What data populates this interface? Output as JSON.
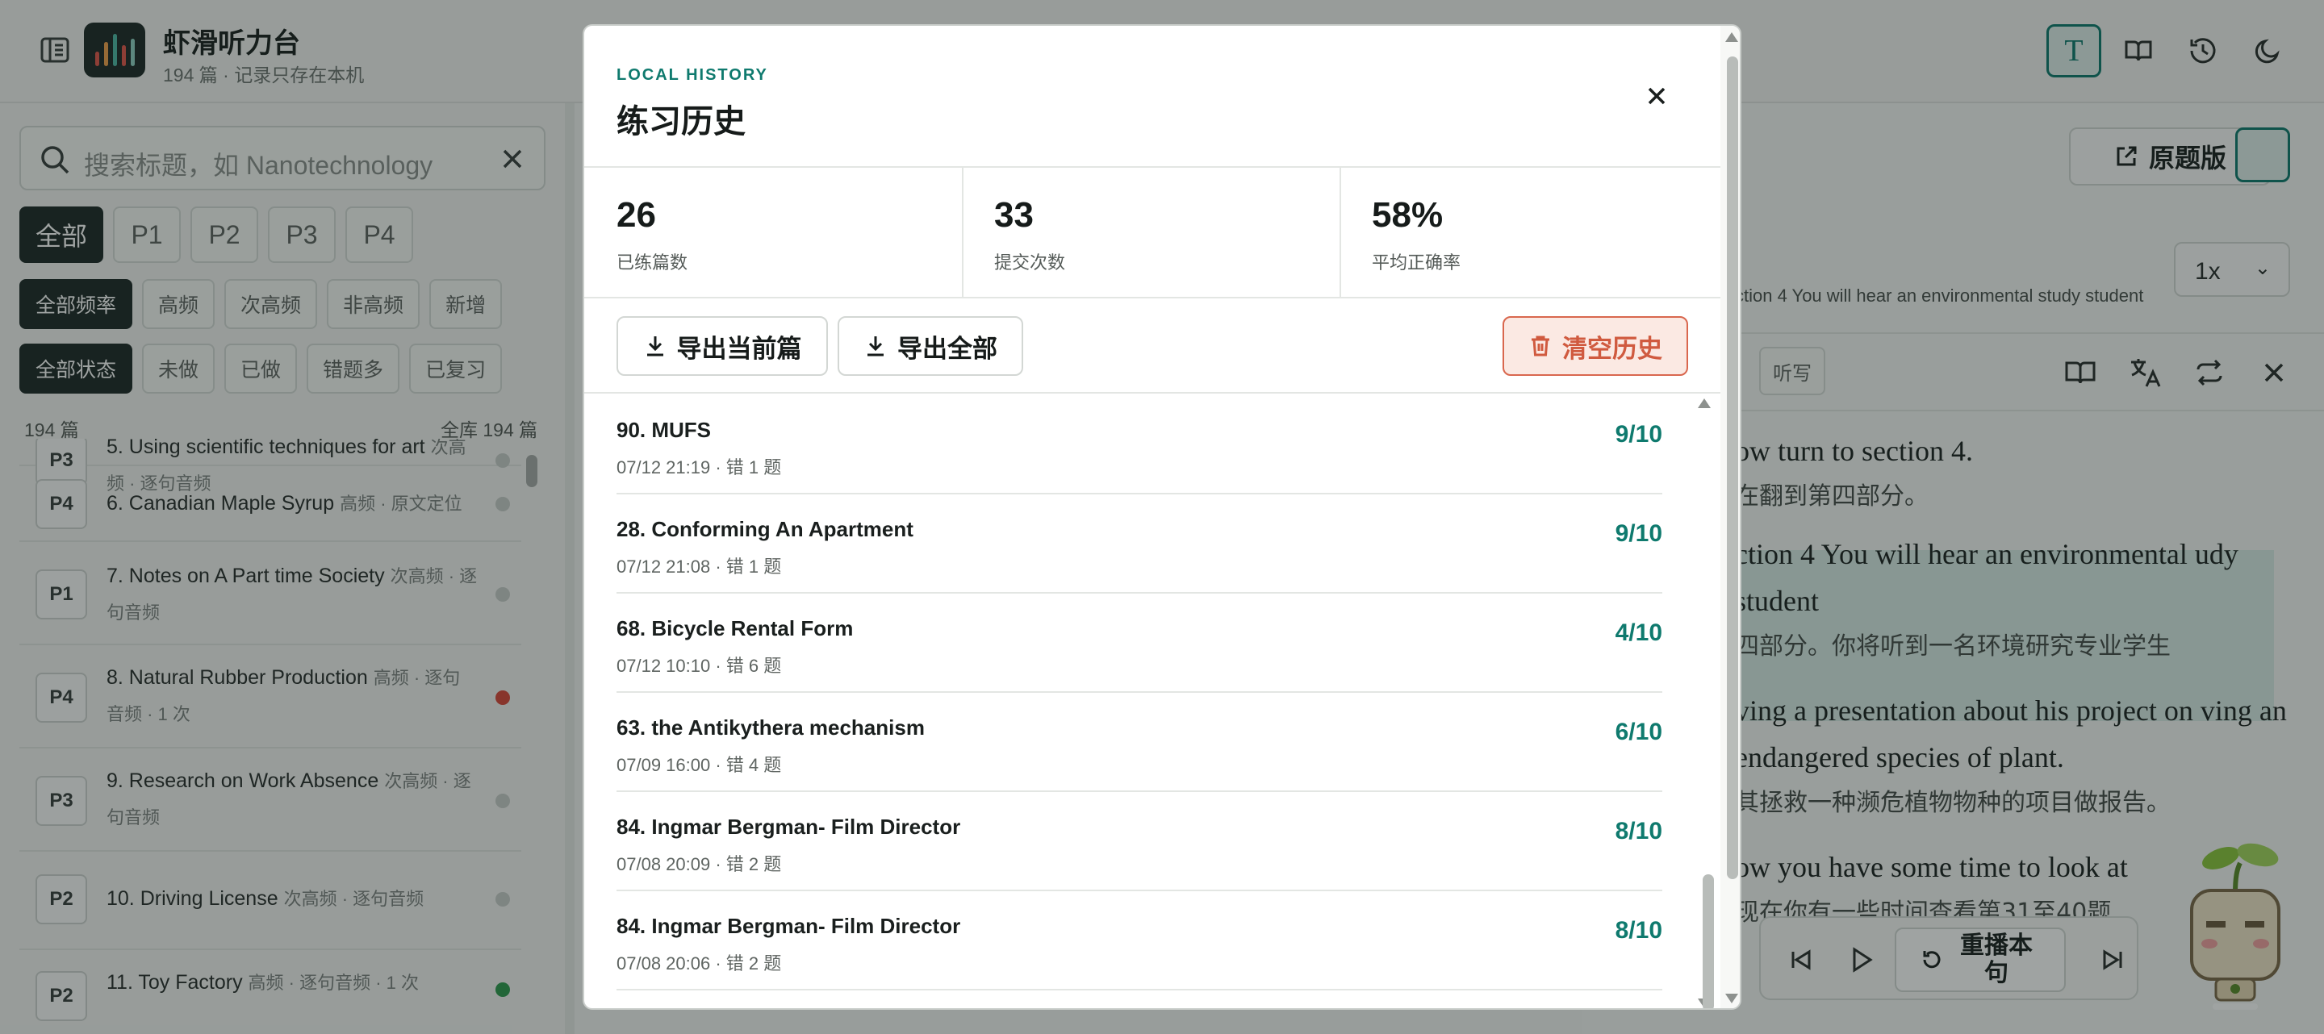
{
  "app": {
    "title": "虾滑听力台",
    "subtitle": "194 篇 · 记录只存在本机",
    "logo_colors": [
      "#e2574c",
      "#f0a04b",
      "#4fb8a6",
      "#e2574c",
      "#8fd1c3"
    ],
    "accent": "#0f7a6e",
    "header_icons": [
      "text-mode-icon",
      "book-icon",
      "history-icon",
      "moon-icon"
    ],
    "text_mode_glyph": "T"
  },
  "sidebar": {
    "search_placeholder": "搜索标题，如 Nanotechnology",
    "part_filters": [
      {
        "label": "全部",
        "active": true
      },
      {
        "label": "P1",
        "active": false
      },
      {
        "label": "P2",
        "active": false
      },
      {
        "label": "P3",
        "active": false
      },
      {
        "label": "P4",
        "active": false
      }
    ],
    "freq_filters": [
      {
        "label": "全部频率",
        "active": true
      },
      {
        "label": "高频",
        "active": false
      },
      {
        "label": "次高频",
        "active": false
      },
      {
        "label": "非高频",
        "active": false
      },
      {
        "label": "新增",
        "active": false
      }
    ],
    "status_filters": [
      {
        "label": "全部状态",
        "active": true
      },
      {
        "label": "未做",
        "active": false
      },
      {
        "label": "已做",
        "active": false
      },
      {
        "label": "错题多",
        "active": false
      },
      {
        "label": "已复习",
        "active": false
      }
    ],
    "count_left": "194 篇",
    "count_right": "全库 194 篇",
    "items": [
      {
        "part": "P3",
        "title": "5. Using scientific techniques for art",
        "meta": "次高频 · 逐句音频",
        "status": "none"
      },
      {
        "part": "P4",
        "title": "6. Canadian Maple Syrup",
        "meta": "高频 · 原文定位",
        "status": "none"
      },
      {
        "part": "P1",
        "title": "7. Notes on A Part time Society",
        "meta": "次高频 · 逐句音频",
        "status": "none"
      },
      {
        "part": "P4",
        "title": "8. Natural Rubber Production",
        "meta": "高频 · 逐句音频 · 1 次",
        "status": "red"
      },
      {
        "part": "P3",
        "title": "9. Research on Work Absence",
        "meta": "次高频 · 逐句音频",
        "status": "none"
      },
      {
        "part": "P2",
        "title": "10. Driving License",
        "meta": "次高频 · 逐句音频",
        "status": "none"
      },
      {
        "part": "P2",
        "title": "11. Toy Factory",
        "meta": "高频 · 逐句音频 · 1 次",
        "status": "green"
      }
    ]
  },
  "reader": {
    "original_button": "原题版",
    "speed": "1x",
    "section_line": "ction 4 You will hear an environmental study student",
    "dict_chip": "听写",
    "transcript": [
      {
        "en": "ow turn to section 4.",
        "zh": "在翻到第四部分。"
      },
      {
        "en": "ction 4 You will hear an environmental udy student",
        "zh": "四部分。你将听到一名环境研究专业学生"
      },
      {
        "en": "ving a presentation about his project on ving an endangered species of plant.",
        "zh": "其拯救一种濒危植物物种的项目做报告。"
      },
      {
        "en": "ow you have some time to look at",
        "zh": "现在你有一些时间查看第31至40题"
      }
    ],
    "replay_label": "重播本句"
  },
  "modal": {
    "kicker": "LOCAL HISTORY",
    "title": "练习历史",
    "stats": [
      {
        "value": "26",
        "label": "已练篇数"
      },
      {
        "value": "33",
        "label": "提交次数"
      },
      {
        "value": "58%",
        "label": "平均正确率"
      }
    ],
    "export_current": "导出当前篇",
    "export_all": "导出全部",
    "clear_history": "清空历史",
    "history": [
      {
        "title": "90. MUFS",
        "meta": "07/12 21:19 · 错 1 题",
        "score": "9/10"
      },
      {
        "title": "28. Conforming An Apartment",
        "meta": "07/12 21:08 · 错 1 题",
        "score": "9/10"
      },
      {
        "title": "68. Bicycle Rental Form",
        "meta": "07/12 10:10 · 错 6 题",
        "score": "4/10"
      },
      {
        "title": "63. the Antikythera mechanism",
        "meta": "07/09 16:00 · 错 4 题",
        "score": "6/10"
      },
      {
        "title": "84. Ingmar Bergman- Film Director",
        "meta": "07/08 20:09 · 错 2 题",
        "score": "8/10"
      },
      {
        "title": "84. Ingmar Bergman- Film Director",
        "meta": "07/08 20:06 · 错 2 题",
        "score": "8/10"
      }
    ]
  }
}
